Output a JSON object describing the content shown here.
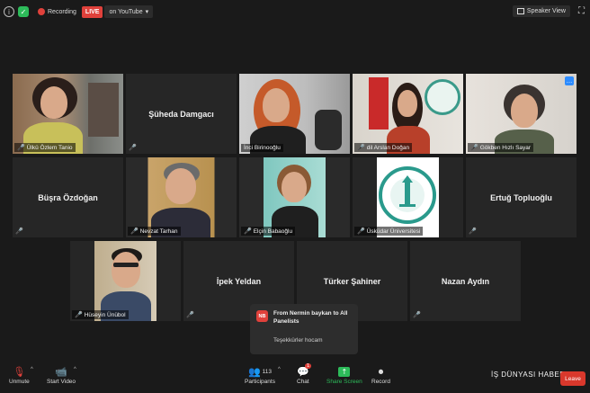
{
  "topbar": {
    "recording_label": "Recording",
    "live_badge": "LIVE",
    "youtube_label": "on YouTube",
    "speaker_view_label": "Speaker View"
  },
  "participants": [
    {
      "name": "Ülkü Özlem Tanio",
      "type": "video"
    },
    {
      "name": "Şüheda Damgacı",
      "type": "name_only"
    },
    {
      "name": "İnci Birinooğlu",
      "type": "video",
      "active_speaker": true
    },
    {
      "name": "dil Arslan Doğan",
      "type": "video"
    },
    {
      "name": "Gökben Hızlı Sayar",
      "type": "video"
    },
    {
      "name": "Büşra Özdoğan",
      "type": "name_only"
    },
    {
      "name": "Nevzat Tarhan",
      "type": "video"
    },
    {
      "name": "Elçin Babaoğlu",
      "type": "video"
    },
    {
      "name": "Üsküdar Üniversitesi",
      "type": "logo",
      "logo_text": "ÜSKÜDAR ÜNİVERSİTESİ"
    },
    {
      "name": "Ertuğ Topluoğlu",
      "type": "name_only"
    },
    {
      "name": "Hüseyin Ünübol",
      "type": "video"
    },
    {
      "name": "İpek Yeldan",
      "type": "name_only"
    },
    {
      "name": "Türker Şahiner",
      "type": "name_only"
    },
    {
      "name": "Nazan Aydın",
      "type": "name_only"
    }
  ],
  "chat_toast": {
    "avatar_initials": "NB",
    "from": "From Nermin baykan to All Panelists",
    "message": "Teşekkürler hocam"
  },
  "toolbar": {
    "unmute": "Unmute",
    "start_video": "Start Video",
    "participants": "Participants",
    "participants_count": "113",
    "chat": "Chat",
    "chat_badge": "1",
    "share_screen": "Share Screen",
    "record": "Record",
    "leave": "Leave"
  },
  "watermark": "İŞ DÜNYASI HABER",
  "colors": {
    "background": "#1a1a1a",
    "tile": "#262626",
    "active_border": "#c4d24a",
    "live_red": "#e0413b",
    "share_green": "#2dbb5a",
    "leave_red": "#d9382c"
  }
}
